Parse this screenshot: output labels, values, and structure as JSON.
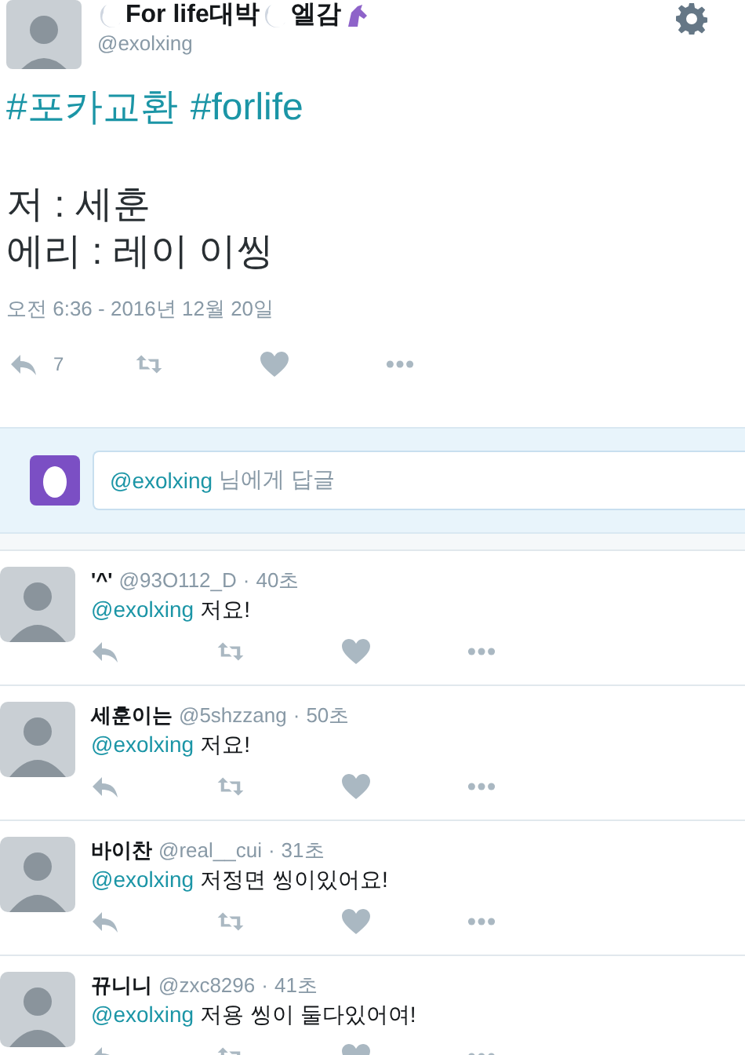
{
  "tweet": {
    "name_parts": [
      {
        "kind": "moon"
      },
      {
        "kind": "text",
        "text": "For life대박"
      },
      {
        "kind": "moon"
      },
      {
        "kind": "text",
        "text": "엘감"
      },
      {
        "kind": "unicorn"
      }
    ],
    "handle": "@exolxing",
    "hashtags": [
      "#포카교환",
      "#forlife"
    ],
    "lines": [
      "저 : 세훈",
      "에리 : 레이 이씽"
    ],
    "timestamp": "오전 6:36 - 2016년 12월 20일",
    "reply_count": "7"
  },
  "reply_box": {
    "mention": "@exolxing",
    "hint": "님에게 답글"
  },
  "replies": [
    {
      "name": "'^'",
      "handle": "@93O112_D",
      "dot": "·",
      "time": "40초",
      "mention": "@exolxing",
      "text": "저요!"
    },
    {
      "name": "세훈이는",
      "handle": "@5shzzang",
      "dot": "·",
      "time": "50초",
      "mention": "@exolxing",
      "text": "저요!"
    },
    {
      "name": "바이찬",
      "handle": "@real__cui",
      "dot": "·",
      "time": "31초",
      "mention": "@exolxing",
      "text": "저정면 씽이있어요!"
    },
    {
      "name": "뀨니니",
      "handle": "@zxc8296",
      "dot": "·",
      "time": "41초",
      "mention": "@exolxing",
      "text": "저용 씽이 둘다있어여!"
    }
  ]
}
